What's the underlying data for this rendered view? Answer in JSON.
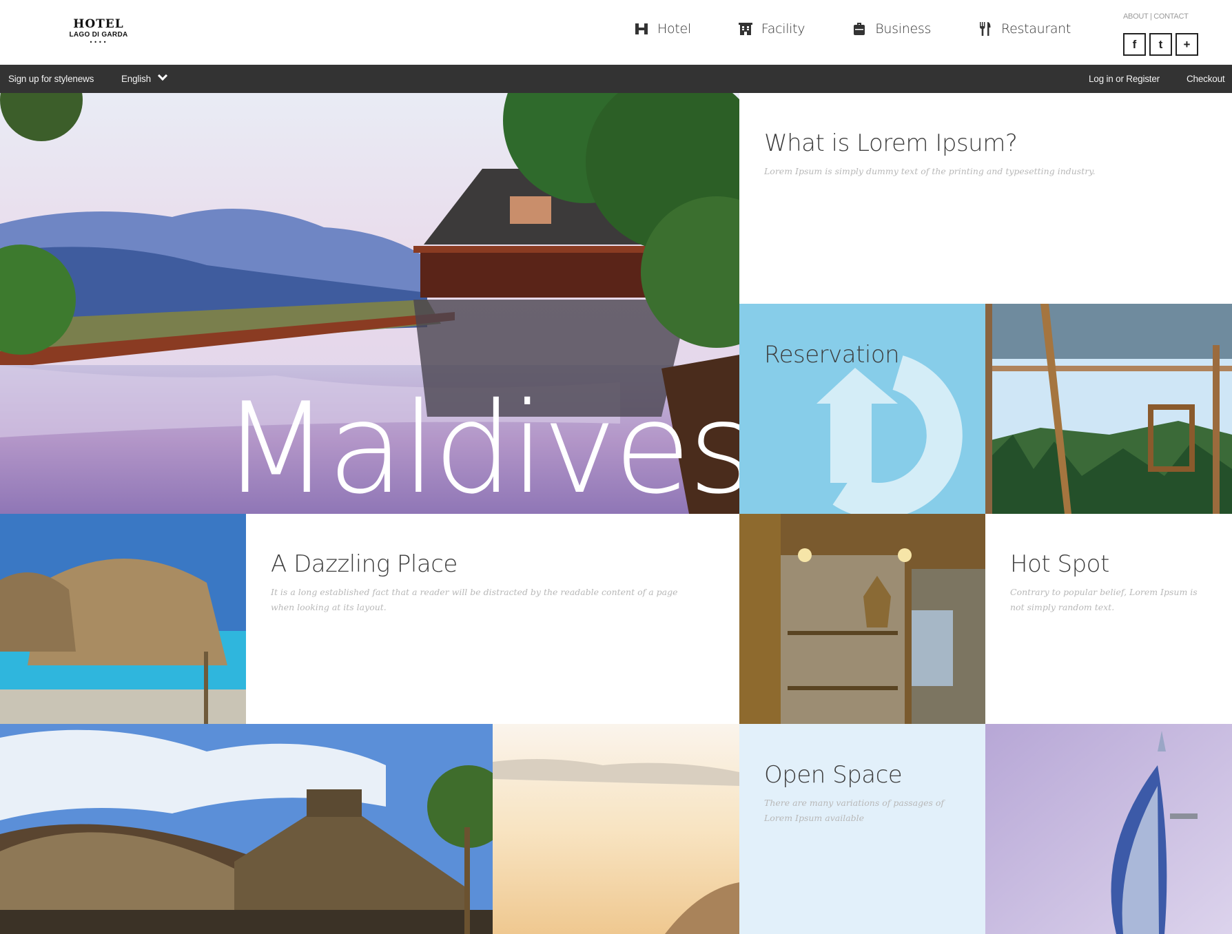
{
  "header": {
    "logo": {
      "line1": "HOTEL",
      "line2": "LAGO DI GARDA",
      "stars": "••••"
    },
    "nav": [
      {
        "label": "Hotel",
        "icon": "hotel-h-icon"
      },
      {
        "label": "Facility",
        "icon": "building-icon"
      },
      {
        "label": "Business",
        "icon": "briefcase-icon"
      },
      {
        "label": "Restaurant",
        "icon": "cutlery-icon"
      }
    ],
    "toplinks": "ABOUT | CONTACT",
    "social": [
      "f",
      "t",
      "+"
    ]
  },
  "subbar": {
    "signup": "Sign up for stylenews",
    "language": "English",
    "login": "Log in or Register",
    "checkout": "Checkout"
  },
  "tiles": {
    "hero": {
      "word": "Maldives"
    },
    "lorem": {
      "title": "What is Lorem Ipsum?",
      "desc": "Lorem Ipsum is simply dummy text of the printing and typesetting industry."
    },
    "reservation": {
      "title": "Reservation",
      "icon": "refresh-icon"
    },
    "dazzling": {
      "title": "A Dazzling Place",
      "desc": "It is a long established fact that a reader will be distracted by the readable content of a page when looking at its layout."
    },
    "hotspot": {
      "title": "Hot Spot",
      "desc": "Contrary to popular belief, Lorem Ipsum is not simply random text."
    },
    "openspace": {
      "title": "Open Space",
      "desc": "There are many variations of passages of Lorem Ipsum available"
    }
  },
  "colors": {
    "subbar": "#333333",
    "reservation_bg": "#87cde9",
    "openspace_bg": "#e2f0fa",
    "text": "#3d3d3d",
    "muted": "#b8b8b8"
  }
}
